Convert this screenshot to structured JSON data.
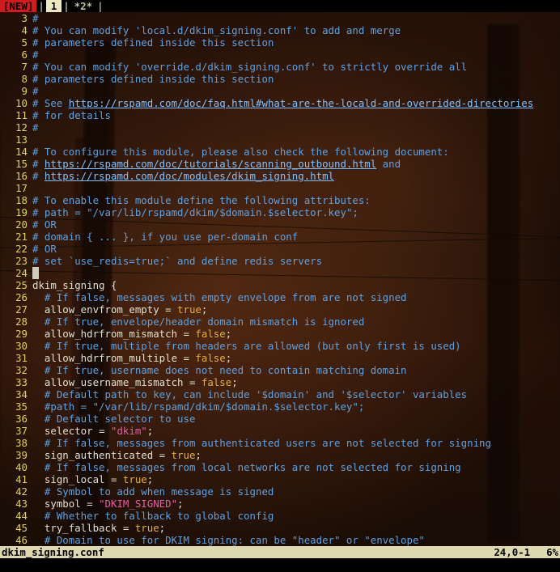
{
  "tabs": {
    "new_label": "[NEW]",
    "sep1": "|",
    "active": "1",
    "sep2": "|",
    "inactive": "*2*",
    "sep3": "|"
  },
  "lines": [
    {
      "n": 3,
      "segs": [
        {
          "c": "comment",
          "t": "#"
        }
      ]
    },
    {
      "n": 4,
      "segs": [
        {
          "c": "comment",
          "t": "# You can modify 'local.d/dkim_signing.conf' to add and merge"
        }
      ]
    },
    {
      "n": 5,
      "segs": [
        {
          "c": "comment",
          "t": "# parameters defined inside this section"
        }
      ]
    },
    {
      "n": 6,
      "segs": [
        {
          "c": "comment",
          "t": "#"
        }
      ]
    },
    {
      "n": 7,
      "segs": [
        {
          "c": "comment",
          "t": "# You can modify 'override.d/dkim_signing.conf' to strictly override all"
        }
      ]
    },
    {
      "n": 8,
      "segs": [
        {
          "c": "comment",
          "t": "# parameters defined inside this section"
        }
      ]
    },
    {
      "n": 9,
      "segs": [
        {
          "c": "comment",
          "t": "#"
        }
      ]
    },
    {
      "n": 10,
      "segs": [
        {
          "c": "comment",
          "t": "# See "
        },
        {
          "c": "link",
          "t": "https://rspamd.com/doc/faq.html#what-are-the-locald-and-overrided-directories"
        }
      ]
    },
    {
      "n": 11,
      "segs": [
        {
          "c": "comment",
          "t": "# for details"
        }
      ]
    },
    {
      "n": 12,
      "segs": [
        {
          "c": "comment",
          "t": "#"
        }
      ]
    },
    {
      "n": 13,
      "segs": []
    },
    {
      "n": 14,
      "segs": [
        {
          "c": "comment",
          "t": "# To configure this module, please also check the following document:"
        }
      ]
    },
    {
      "n": 15,
      "segs": [
        {
          "c": "comment",
          "t": "# "
        },
        {
          "c": "link",
          "t": "https://rspamd.com/doc/tutorials/scanning_outbound.html"
        },
        {
          "c": "comment",
          "t": " and"
        }
      ]
    },
    {
      "n": 16,
      "segs": [
        {
          "c": "comment",
          "t": "# "
        },
        {
          "c": "link",
          "t": "https://rspamd.com/doc/modules/dkim_signing.html"
        }
      ]
    },
    {
      "n": 17,
      "segs": []
    },
    {
      "n": 18,
      "segs": [
        {
          "c": "comment",
          "t": "# To enable this module define the following attributes:"
        }
      ]
    },
    {
      "n": 19,
      "segs": [
        {
          "c": "comment",
          "t": "# path = \"/var/lib/rspamd/dkim/$domain.$selector.key\";"
        }
      ]
    },
    {
      "n": 20,
      "segs": [
        {
          "c": "comment",
          "t": "# OR"
        }
      ]
    },
    {
      "n": 21,
      "segs": [
        {
          "c": "comment",
          "t": "# domain { ... }, if you use per-domain conf"
        }
      ]
    },
    {
      "n": 22,
      "segs": [
        {
          "c": "comment",
          "t": "# OR"
        }
      ]
    },
    {
      "n": 23,
      "segs": [
        {
          "c": "comment",
          "t": "# set `use_redis=true;` and define redis servers"
        }
      ]
    },
    {
      "n": 24,
      "cursor": true,
      "segs": []
    },
    {
      "n": 25,
      "segs": [
        {
          "c": "ident",
          "t": "dkim_signing "
        },
        {
          "c": "op",
          "t": "{"
        }
      ]
    },
    {
      "n": 26,
      "segs": [
        {
          "c": "comment",
          "t": "  # If false, messages with empty envelope from are not signed"
        }
      ]
    },
    {
      "n": 27,
      "segs": [
        {
          "c": "ident",
          "t": "  allow_envfrom_empty "
        },
        {
          "c": "op",
          "t": "= "
        },
        {
          "c": "kw",
          "t": "true"
        },
        {
          "c": "op",
          "t": ";"
        }
      ]
    },
    {
      "n": 28,
      "segs": [
        {
          "c": "comment",
          "t": "  # If true, envelope/header domain mismatch is ignored"
        }
      ]
    },
    {
      "n": 29,
      "segs": [
        {
          "c": "ident",
          "t": "  allow_hdrfrom_mismatch "
        },
        {
          "c": "op",
          "t": "= "
        },
        {
          "c": "kw",
          "t": "false"
        },
        {
          "c": "op",
          "t": ";"
        }
      ]
    },
    {
      "n": 30,
      "segs": [
        {
          "c": "comment",
          "t": "  # If true, multiple from headers are allowed (but only first is used)"
        }
      ]
    },
    {
      "n": 31,
      "segs": [
        {
          "c": "ident",
          "t": "  allow_hdrfrom_multiple "
        },
        {
          "c": "op",
          "t": "= "
        },
        {
          "c": "kw",
          "t": "false"
        },
        {
          "c": "op",
          "t": ";"
        }
      ]
    },
    {
      "n": 32,
      "segs": [
        {
          "c": "comment",
          "t": "  # If true, username does not need to contain matching domain"
        }
      ]
    },
    {
      "n": 33,
      "segs": [
        {
          "c": "ident",
          "t": "  allow_username_mismatch "
        },
        {
          "c": "op",
          "t": "= "
        },
        {
          "c": "kw",
          "t": "false"
        },
        {
          "c": "op",
          "t": ";"
        }
      ]
    },
    {
      "n": 34,
      "segs": [
        {
          "c": "comment",
          "t": "  # Default path to key, can include '$domain' and '$selector' variables"
        }
      ]
    },
    {
      "n": 35,
      "segs": [
        {
          "c": "comment",
          "t": "  #path = \"/var/lib/rspamd/dkim/$domain.$selector.key\";"
        }
      ]
    },
    {
      "n": 36,
      "segs": [
        {
          "c": "comment",
          "t": "  # Default selector to use"
        }
      ]
    },
    {
      "n": 37,
      "segs": [
        {
          "c": "ident",
          "t": "  selector "
        },
        {
          "c": "op",
          "t": "= "
        },
        {
          "c": "string",
          "t": "\"dkim\""
        },
        {
          "c": "op",
          "t": ";"
        }
      ]
    },
    {
      "n": 38,
      "segs": [
        {
          "c": "comment",
          "t": "  # If false, messages from authenticated users are not selected for signing"
        }
      ]
    },
    {
      "n": 39,
      "segs": [
        {
          "c": "ident",
          "t": "  sign_authenticated "
        },
        {
          "c": "op",
          "t": "= "
        },
        {
          "c": "kw",
          "t": "true"
        },
        {
          "c": "op",
          "t": ";"
        }
      ]
    },
    {
      "n": 40,
      "segs": [
        {
          "c": "comment",
          "t": "  # If false, messages from local networks are not selected for signing"
        }
      ]
    },
    {
      "n": 41,
      "segs": [
        {
          "c": "ident",
          "t": "  sign_local "
        },
        {
          "c": "op",
          "t": "= "
        },
        {
          "c": "kw",
          "t": "true"
        },
        {
          "c": "op",
          "t": ";"
        }
      ]
    },
    {
      "n": 42,
      "segs": [
        {
          "c": "comment",
          "t": "  # Symbol to add when message is signed"
        }
      ]
    },
    {
      "n": 43,
      "segs": [
        {
          "c": "ident",
          "t": "  symbol "
        },
        {
          "c": "op",
          "t": "= "
        },
        {
          "c": "string",
          "t": "\"DKIM_SIGNED\""
        },
        {
          "c": "op",
          "t": ";"
        }
      ]
    },
    {
      "n": 44,
      "segs": [
        {
          "c": "comment",
          "t": "  # Whether to fallback to global config"
        }
      ]
    },
    {
      "n": 45,
      "segs": [
        {
          "c": "ident",
          "t": "  try_fallback "
        },
        {
          "c": "op",
          "t": "= "
        },
        {
          "c": "kw",
          "t": "true"
        },
        {
          "c": "op",
          "t": ";"
        }
      ]
    },
    {
      "n": 46,
      "segs": [
        {
          "c": "comment",
          "t": "  # Domain to use for DKIM signing: can be \"header\" or \"envelope\""
        }
      ]
    }
  ],
  "status": {
    "filename": "dkim_signing.conf",
    "position": "24,0-1",
    "percent": "6%"
  }
}
